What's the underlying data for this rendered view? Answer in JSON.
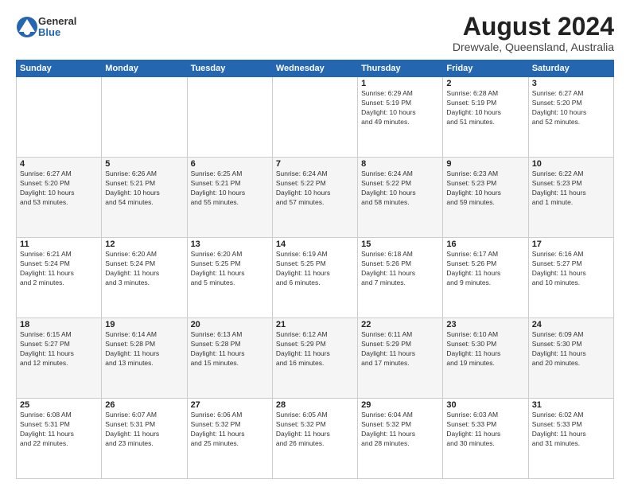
{
  "header": {
    "logo": {
      "line1": "General",
      "line2": "Blue"
    },
    "title": "August 2024",
    "subtitle": "Drewvale, Queensland, Australia"
  },
  "weekdays": [
    "Sunday",
    "Monday",
    "Tuesday",
    "Wednesday",
    "Thursday",
    "Friday",
    "Saturday"
  ],
  "weeks": [
    [
      {
        "day": "",
        "info": ""
      },
      {
        "day": "",
        "info": ""
      },
      {
        "day": "",
        "info": ""
      },
      {
        "day": "",
        "info": ""
      },
      {
        "day": "1",
        "info": "Sunrise: 6:29 AM\nSunset: 5:19 PM\nDaylight: 10 hours\nand 49 minutes."
      },
      {
        "day": "2",
        "info": "Sunrise: 6:28 AM\nSunset: 5:19 PM\nDaylight: 10 hours\nand 51 minutes."
      },
      {
        "day": "3",
        "info": "Sunrise: 6:27 AM\nSunset: 5:20 PM\nDaylight: 10 hours\nand 52 minutes."
      }
    ],
    [
      {
        "day": "4",
        "info": "Sunrise: 6:27 AM\nSunset: 5:20 PM\nDaylight: 10 hours\nand 53 minutes."
      },
      {
        "day": "5",
        "info": "Sunrise: 6:26 AM\nSunset: 5:21 PM\nDaylight: 10 hours\nand 54 minutes."
      },
      {
        "day": "6",
        "info": "Sunrise: 6:25 AM\nSunset: 5:21 PM\nDaylight: 10 hours\nand 55 minutes."
      },
      {
        "day": "7",
        "info": "Sunrise: 6:24 AM\nSunset: 5:22 PM\nDaylight: 10 hours\nand 57 minutes."
      },
      {
        "day": "8",
        "info": "Sunrise: 6:24 AM\nSunset: 5:22 PM\nDaylight: 10 hours\nand 58 minutes."
      },
      {
        "day": "9",
        "info": "Sunrise: 6:23 AM\nSunset: 5:23 PM\nDaylight: 10 hours\nand 59 minutes."
      },
      {
        "day": "10",
        "info": "Sunrise: 6:22 AM\nSunset: 5:23 PM\nDaylight: 11 hours\nand 1 minute."
      }
    ],
    [
      {
        "day": "11",
        "info": "Sunrise: 6:21 AM\nSunset: 5:24 PM\nDaylight: 11 hours\nand 2 minutes."
      },
      {
        "day": "12",
        "info": "Sunrise: 6:20 AM\nSunset: 5:24 PM\nDaylight: 11 hours\nand 3 minutes."
      },
      {
        "day": "13",
        "info": "Sunrise: 6:20 AM\nSunset: 5:25 PM\nDaylight: 11 hours\nand 5 minutes."
      },
      {
        "day": "14",
        "info": "Sunrise: 6:19 AM\nSunset: 5:25 PM\nDaylight: 11 hours\nand 6 minutes."
      },
      {
        "day": "15",
        "info": "Sunrise: 6:18 AM\nSunset: 5:26 PM\nDaylight: 11 hours\nand 7 minutes."
      },
      {
        "day": "16",
        "info": "Sunrise: 6:17 AM\nSunset: 5:26 PM\nDaylight: 11 hours\nand 9 minutes."
      },
      {
        "day": "17",
        "info": "Sunrise: 6:16 AM\nSunset: 5:27 PM\nDaylight: 11 hours\nand 10 minutes."
      }
    ],
    [
      {
        "day": "18",
        "info": "Sunrise: 6:15 AM\nSunset: 5:27 PM\nDaylight: 11 hours\nand 12 minutes."
      },
      {
        "day": "19",
        "info": "Sunrise: 6:14 AM\nSunset: 5:28 PM\nDaylight: 11 hours\nand 13 minutes."
      },
      {
        "day": "20",
        "info": "Sunrise: 6:13 AM\nSunset: 5:28 PM\nDaylight: 11 hours\nand 15 minutes."
      },
      {
        "day": "21",
        "info": "Sunrise: 6:12 AM\nSunset: 5:29 PM\nDaylight: 11 hours\nand 16 minutes."
      },
      {
        "day": "22",
        "info": "Sunrise: 6:11 AM\nSunset: 5:29 PM\nDaylight: 11 hours\nand 17 minutes."
      },
      {
        "day": "23",
        "info": "Sunrise: 6:10 AM\nSunset: 5:30 PM\nDaylight: 11 hours\nand 19 minutes."
      },
      {
        "day": "24",
        "info": "Sunrise: 6:09 AM\nSunset: 5:30 PM\nDaylight: 11 hours\nand 20 minutes."
      }
    ],
    [
      {
        "day": "25",
        "info": "Sunrise: 6:08 AM\nSunset: 5:31 PM\nDaylight: 11 hours\nand 22 minutes."
      },
      {
        "day": "26",
        "info": "Sunrise: 6:07 AM\nSunset: 5:31 PM\nDaylight: 11 hours\nand 23 minutes."
      },
      {
        "day": "27",
        "info": "Sunrise: 6:06 AM\nSunset: 5:32 PM\nDaylight: 11 hours\nand 25 minutes."
      },
      {
        "day": "28",
        "info": "Sunrise: 6:05 AM\nSunset: 5:32 PM\nDaylight: 11 hours\nand 26 minutes."
      },
      {
        "day": "29",
        "info": "Sunrise: 6:04 AM\nSunset: 5:32 PM\nDaylight: 11 hours\nand 28 minutes."
      },
      {
        "day": "30",
        "info": "Sunrise: 6:03 AM\nSunset: 5:33 PM\nDaylight: 11 hours\nand 30 minutes."
      },
      {
        "day": "31",
        "info": "Sunrise: 6:02 AM\nSunset: 5:33 PM\nDaylight: 11 hours\nand 31 minutes."
      }
    ]
  ]
}
